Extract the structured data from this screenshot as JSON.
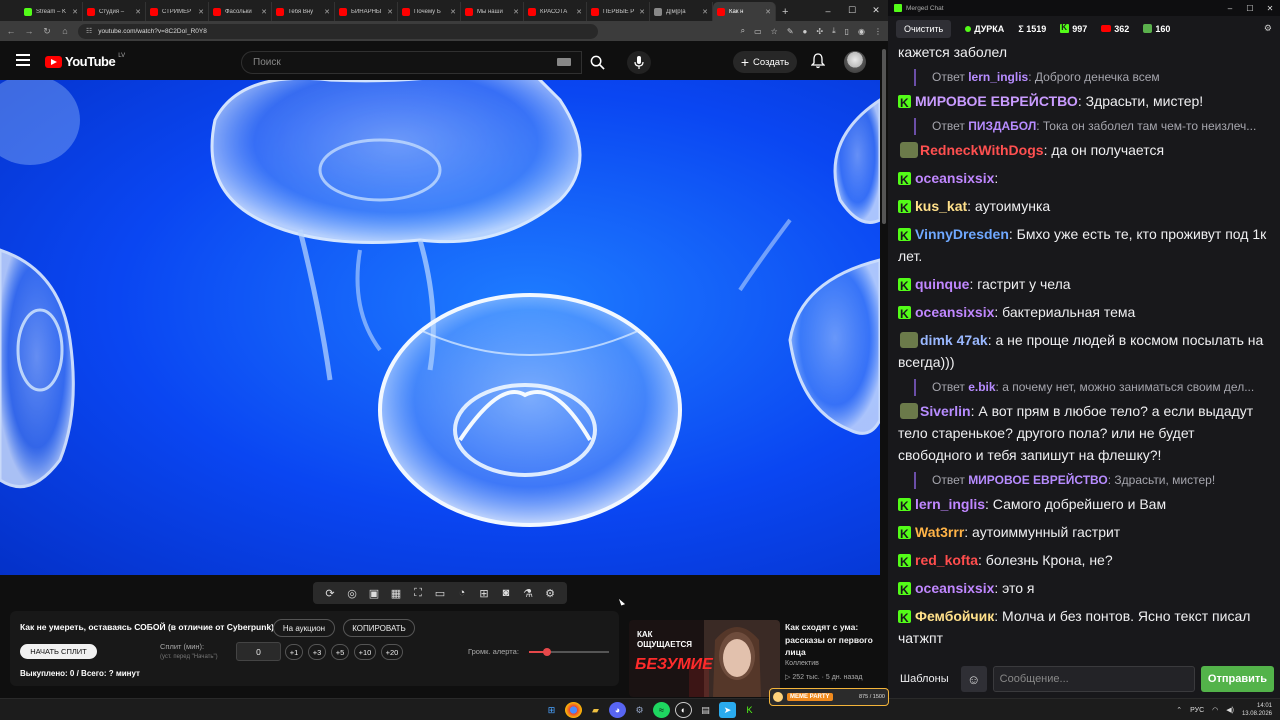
{
  "browser": {
    "tabs": [
      {
        "label": "Stream – K",
        "color": "#53fc18"
      },
      {
        "label": "Студия –",
        "color": "#ff0000"
      },
      {
        "label": "СТРИМЕР",
        "color": "#ff0000"
      },
      {
        "label": "Фасольки",
        "color": "#ff0000"
      },
      {
        "label": "Тебя Вну",
        "color": "#ff0000"
      },
      {
        "label": "БИНАРНЫ",
        "color": "#ff0000"
      },
      {
        "label": "Почему Б",
        "color": "#ff0000"
      },
      {
        "label": "Мы наши",
        "color": "#ff0000"
      },
      {
        "label": "КРАСОТА",
        "color": "#ff0000"
      },
      {
        "label": "ПЕРВЫЕ Р",
        "color": "#ff0000"
      },
      {
        "label": "Д|м|р|а",
        "color": "#888888"
      },
      {
        "label": "Как н",
        "color": "#ff0000",
        "active": true
      }
    ],
    "url": "youtube.com/watch?v=8C2DoI_R0Y8"
  },
  "youtube": {
    "logo_text": "YouTube",
    "logo_country": "LV",
    "search_placeholder": "Поиск",
    "create_label": "Создать"
  },
  "split_panel": {
    "video_title": "Как не умереть, оставаясь СОБОЙ (в отличие от Cyberpunk)",
    "auction_button": "На аукцион",
    "copy_button": "КОПИРОВАТЬ",
    "start_split_button": "НАЧАТЬ СПЛИТ",
    "split_label": "Сплит (мин):",
    "split_hint": "(уст. перед \"Начать\")",
    "split_value": "0",
    "steps": [
      "+1",
      "+3",
      "+5",
      "+10",
      "+20"
    ],
    "bought_text": "Выкуплено: 0 / Всего: ? минут",
    "alert_volume_label": "Громк. алерта:",
    "alert_volume_fraction": 0.22
  },
  "recommendation": {
    "thumb_text_1": "КАК",
    "thumb_text_2": "ОЩУЩАЕТСЯ",
    "thumb_text_3": "БЕЗУМИЕ",
    "title": "Как сходят с ума: рассказы от первого лица",
    "channel": "Коллектив",
    "meta": "▷ 252 тыс. · 5 дн. назад"
  },
  "chat": {
    "window_title": "Merged Chat",
    "clear_button": "Очистить",
    "channel_name": "ДУРКА",
    "total_count": "Σ 1519",
    "kick_count": "997",
    "yt_count": "362",
    "other_count": "160",
    "messages": [
      {
        "type": "text",
        "text": "кажется заболел"
      },
      {
        "type": "reply",
        "prefix": "Ответ",
        "user": "lern_inglis",
        "user_color": "#b78cff",
        "text": ": Доброго денечка всем"
      },
      {
        "type": "msg",
        "user": "МИРОВОЕ ЕВРЕЙСТВО",
        "user_color": "#c99bff",
        "text": ": Здрасьти, мистер!",
        "badge": true
      },
      {
        "type": "reply",
        "prefix": "Ответ",
        "user": "ПИЗДАБОЛ",
        "user_color": "#b78cff",
        "text": ": Тока он заболел там чем-то неизлеч..."
      },
      {
        "type": "msg",
        "user": "RedneckWithDogs",
        "user_color": "#ff5050",
        "text": ": да он получается",
        "badge": false
      },
      {
        "type": "msg",
        "user": "oceansixsix",
        "user_color": "#c087ff",
        "text": ":",
        "badge": true
      },
      {
        "type": "msg",
        "user": "kus_kat",
        "user_color": "#ffe08a",
        "text": ": аутоимунка",
        "badge": true
      },
      {
        "type": "msg",
        "user": "VinnyDresden",
        "user_color": "#6fa8ff",
        "text": ": Бмхо уже есть те, кто проживут под 1к лет.",
        "badge": true
      },
      {
        "type": "msg",
        "user": "quinque",
        "user_color": "#c087ff",
        "text": ": гастрит у чела",
        "badge": true
      },
      {
        "type": "msg",
        "user": "oceansixsix",
        "user_color": "#c087ff",
        "text": ": бактериальная тема",
        "badge": true
      },
      {
        "type": "msg",
        "user": "dimk 47ak",
        "user_color": "#9ab8ff",
        "text": ": а не проще людей в космом посылать на всегда)))",
        "badge": false
      },
      {
        "type": "reply",
        "prefix": "Ответ",
        "user": "e.bik",
        "user_color": "#b78cff",
        "text": ": а почему нет, можно заниматься своим дел..."
      },
      {
        "type": "msg",
        "user": "Siverlin",
        "user_color": "#b78cff",
        "text": ": А вот прям в любое тело? а если выдадут тело старенькое? другого пола? или не будет свободного и тебя запишут на флешку?!",
        "badge": false
      },
      {
        "type": "reply",
        "prefix": "Ответ",
        "user": "МИРОВОЕ ЕВРЕЙСТВО",
        "user_color": "#b78cff",
        "text": ": Здрасьти, мистер!"
      },
      {
        "type": "msg",
        "user": "lern_inglis",
        "user_color": "#c087ff",
        "text": ": Самого добрейшего и Вам",
        "badge": true
      },
      {
        "type": "msg",
        "user": "Wat3rrr",
        "user_color": "#ffb347",
        "text": ": аутоиммунный гастрит",
        "badge": true
      },
      {
        "type": "msg",
        "user": "red_kofta",
        "user_color": "#ff4d4d",
        "text": ": болезнь Крона, не?",
        "badge": true
      },
      {
        "type": "msg",
        "user": "oceansixsix",
        "user_color": "#c087ff",
        "text": ": это я",
        "badge": true
      },
      {
        "type": "msg",
        "user": "Фембойчик",
        "user_color": "#ffe08a",
        "text": ": Молча и без понтов. Ясно текст писал чатжпт",
        "badge": true
      }
    ],
    "templates_button": "Шаблоны",
    "input_placeholder": "Сообщение...",
    "send_button": "Отправить"
  },
  "taskbar": {
    "meme_party_label": "MEME PARTY",
    "meme_party_value": "875 / 1500",
    "lang": "РУС",
    "time": "14:01",
    "date": "13.08.2026"
  },
  "colors": {
    "kick_green": "#53fc18",
    "yt_red": "#ff0000",
    "video_blue": "#0a46f2",
    "send_green": "#53b34a"
  }
}
